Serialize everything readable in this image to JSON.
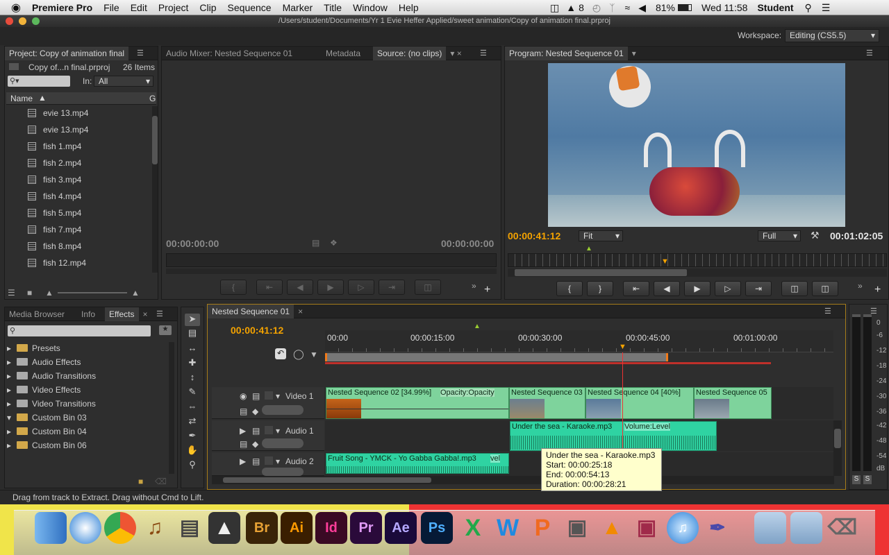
{
  "menubar": {
    "apple": "",
    "app": "Premiere Pro",
    "items": [
      "File",
      "Edit",
      "Project",
      "Clip",
      "Sequence",
      "Marker",
      "Title",
      "Window",
      "Help"
    ],
    "status": {
      "notif": "8",
      "battery": "81%",
      "clock": "Wed 11:58",
      "user": "Student"
    }
  },
  "window": {
    "path": "/Users/student/Documents/Yr 1 Evie Heffer Applied/sweet animation/Copy of animation final.prproj"
  },
  "workspace": {
    "label": "Workspace:",
    "value": "Editing (CS5.5)"
  },
  "project": {
    "tab": "Project: Copy of animation final",
    "file": "Copy of...n final.prproj",
    "count": "26 Items",
    "in_label": "In:",
    "in_value": "All",
    "col_name": "Name",
    "col_extra": "G",
    "items": [
      "evie 13.mp4",
      "evie 13.mp4",
      "fish 1.mp4",
      "fish 2.mp4",
      "fish 3.mp4",
      "fish 4.mp4",
      "fish 5.mp4",
      "fish 7.mp4",
      "fish 8.mp4",
      "fish 12.mp4"
    ]
  },
  "source": {
    "tabs": [
      "Audio Mixer: Nested Sequence 01",
      "Metadata",
      "Source: (no clips)"
    ],
    "tc_left": "00:00:00:00",
    "tc_right": "00:00:00:00"
  },
  "program": {
    "tab": "Program: Nested Sequence 01",
    "tc_current": "00:00:41:12",
    "fit": "Fit",
    "quality": "Full",
    "tc_duration": "00:01:02:05"
  },
  "effects": {
    "tabs": [
      "Media Browser",
      "Info",
      "Effects"
    ],
    "items": [
      {
        "label": "Presets",
        "expanded": false
      },
      {
        "label": "Audio Effects",
        "expanded": false
      },
      {
        "label": "Audio Transitions",
        "expanded": false
      },
      {
        "label": "Video Effects",
        "expanded": false
      },
      {
        "label": "Video Transitions",
        "expanded": false
      },
      {
        "label": "Custom Bin 03",
        "expanded": true
      },
      {
        "label": "Custom Bin 04",
        "expanded": false
      },
      {
        "label": "Custom Bin 06",
        "expanded": false
      }
    ]
  },
  "timeline": {
    "tab": "Nested Sequence 01",
    "tc": "00:00:41:12",
    "ruler": [
      "00:00",
      "00:00:15:00",
      "00:00:30:00",
      "00:00:45:00",
      "00:01:00:00"
    ],
    "tracks": {
      "video1": "Video 1",
      "audio1": "Audio 1",
      "audio2": "Audio 2"
    },
    "video_clips": [
      {
        "label": "Nested Sequence 02 [34.99%]",
        "fx": "Opacity:Opacity"
      },
      {
        "label": "Nested Sequence 03"
      },
      {
        "label": "Nested Sequence 04 [40%]"
      },
      {
        "label": "Nested Sequence 05"
      }
    ],
    "audio_clips": [
      {
        "label": "Under the sea - Karaoke.mp3",
        "fx": "Volume:Level"
      },
      {
        "label": "Fruit Song - YMCK - Yo Gabba Gabba!.mp3",
        "fx": "vel"
      }
    ],
    "tooltip": {
      "name": "Under the sea - Karaoke.mp3",
      "start": "Start: 00:00:25:18",
      "end": "End: 00:00:54:13",
      "duration": "Duration: 00:00:28:21"
    }
  },
  "meter": {
    "labels": [
      "0",
      "-6",
      "-12",
      "-18",
      "-24",
      "-30",
      "-36",
      "-42",
      "-48",
      "-54",
      "dB"
    ],
    "solo": [
      "S",
      "S"
    ]
  },
  "statusbar": {
    "text": "Drag from track to Extract. Drag without Cmd to Lift."
  },
  "dock": {
    "apps": [
      "Finder",
      "Safari",
      "Chrome",
      "GarageBand",
      "Screenshot",
      "Dragon",
      "Br",
      "Ai",
      "Id",
      "Pr",
      "Ae",
      "Ps",
      "X",
      "W",
      "P",
      "iPhoto",
      "VLC",
      "Photo Booth",
      "iTunes",
      "Pen",
      "Folder",
      "Folder",
      "Trash"
    ]
  }
}
